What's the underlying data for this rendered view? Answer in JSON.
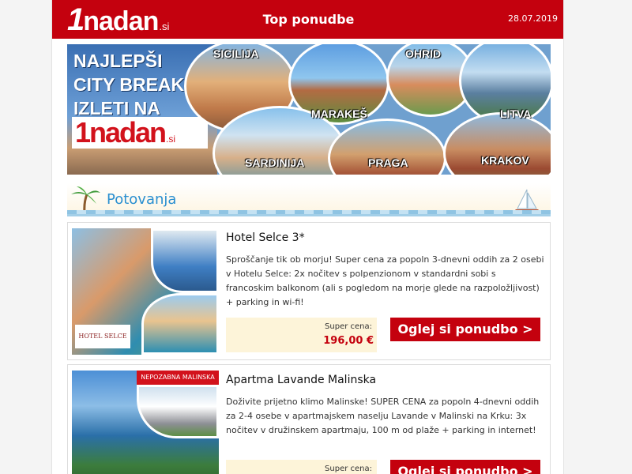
{
  "header": {
    "logo_one": "1",
    "logo_word": "nadan",
    "logo_tld": ".si",
    "title": "Top ponudbe",
    "date": "28.07.2019"
  },
  "banner": {
    "headline_lines": [
      "NAJLEPŠI",
      "CITY BREAK",
      "IZLETI NA"
    ],
    "logo_one": "1",
    "logo_word": "nadan",
    "logo_tld": ".si",
    "cities": [
      "SICILIJA",
      "MARAKEŠ",
      "OHRID",
      "LITVA",
      "SARDINIJA",
      "PRAGA",
      "KRAKOV"
    ]
  },
  "section": {
    "title": "Potovanja"
  },
  "offers": [
    {
      "title": "Hotel Selce 3*",
      "description": "Sproščanje tik ob morju! Super cena za popoln 3-dnevni oddih za 2 osebi v Hotelu Selce: 2x nočitev s polpenzionom v standardni sobi s francoskim balkonom (ali s pogledom na morje glede na razpoložljivost) + parking in wi-fi!",
      "price_label": "Super cena:",
      "price": "196,00 €",
      "cta": "Oglej si ponudbo >",
      "image_caption": "HOTEL SELCE"
    },
    {
      "title": "Apartma Lavande Malinska",
      "description": "Doživite prijetno klimo Malinske! SUPER CENA za popoln 4-dnevni oddih za 2-4 osebe v apartmajskem naselju Lavande v Malinski na Krku: 3x nočitev v družinskem apartmaju, 100 m od plaže + parking in internet!",
      "price_label": "Super cena:",
      "price": "",
      "cta": "Oglej si ponudbo >",
      "image_caption": "NEPOZABNA MALINSKA"
    }
  ],
  "colors": {
    "brand_red": "#c4010e",
    "section_blue": "#2a8fd0",
    "price_bg": "#fdf4d9"
  }
}
